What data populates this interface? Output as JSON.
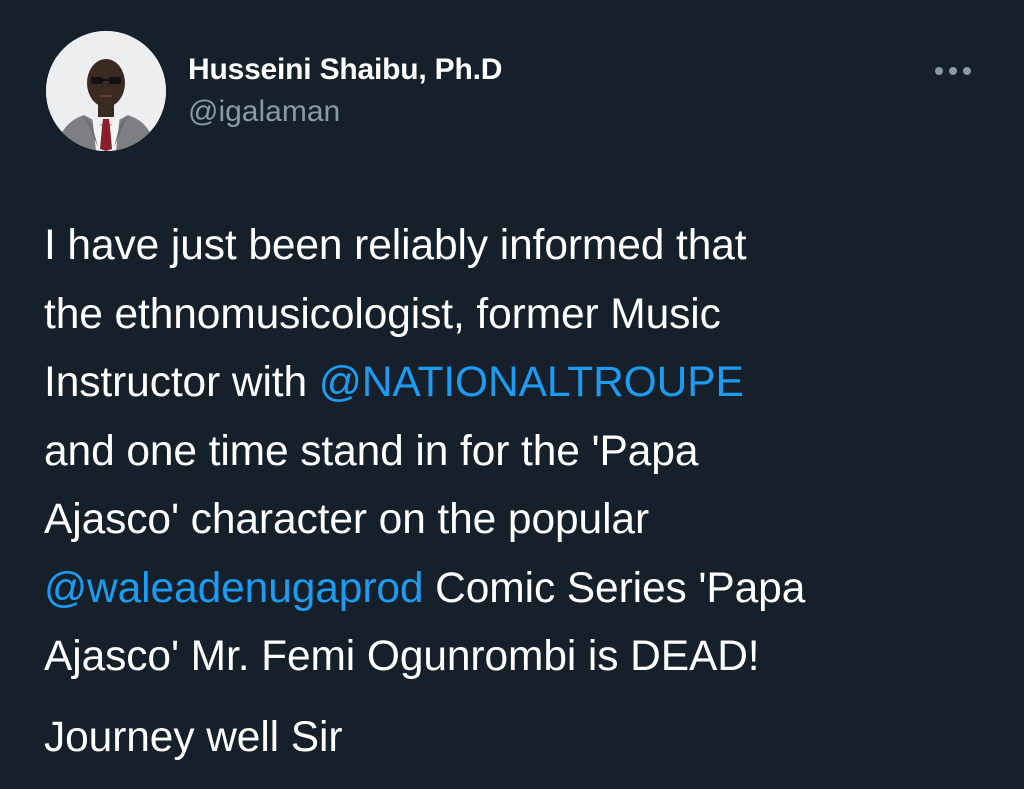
{
  "author": {
    "display_name": "Husseini Shaibu, Ph.D",
    "handle": "@igalaman"
  },
  "header": {
    "more_icon": "more-horizontal-icon"
  },
  "tweet": {
    "lines": [
      "I have just been reliably informed that",
      "the ethnomusicologist, former Music",
      "Instructor with "
    ],
    "mention_1": "@NATIONALTROUPE",
    "lines_2": [
      "and one time stand in for the 'Papa",
      "Ajasco' character on the popular"
    ],
    "mention_2": "@waleadenugaprod",
    "after_mention_2": " Comic Series 'Papa",
    "line_last": "Ajasco' Mr. Femi Ogunrombi is DEAD!",
    "closing": "Journey well Sir"
  },
  "colors": {
    "background": "#15202b",
    "text": "#ffffff",
    "secondary_text": "#8b98a5",
    "link": "#1d9bf0"
  }
}
